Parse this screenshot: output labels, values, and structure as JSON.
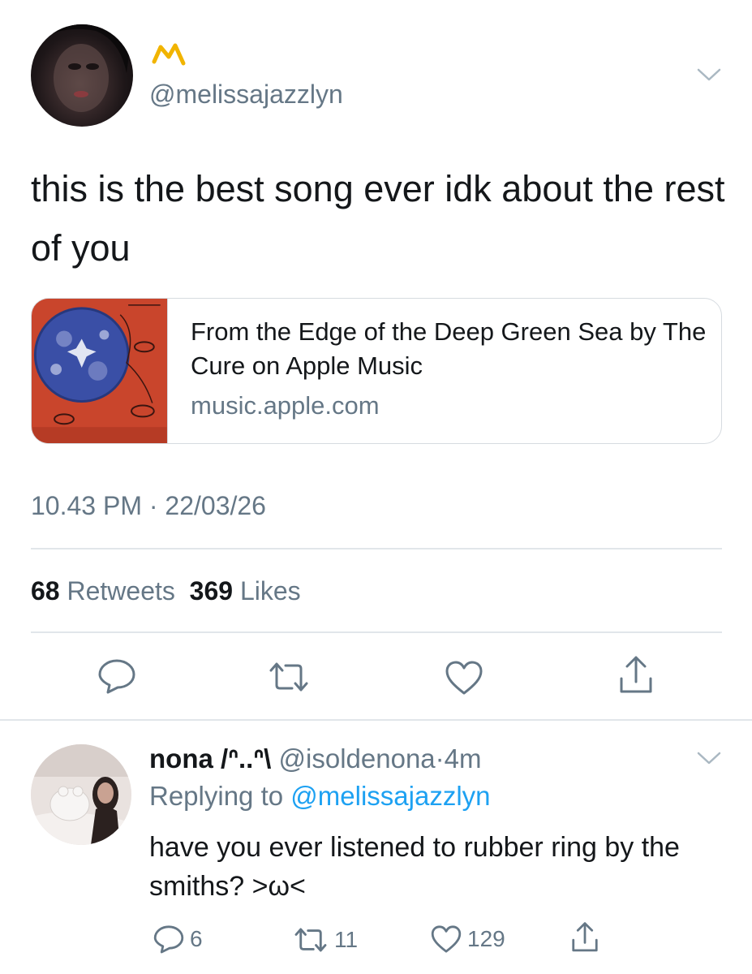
{
  "tweet": {
    "author_handle": "@melissajazzlyn",
    "text": "this is the best song ever idk about the rest of you",
    "link_card": {
      "title": "From the Edge of the Deep Green Sea by The Cure on Apple Music",
      "domain": "music.apple.com"
    },
    "timestamp": "10.43 PM · 22/03/26",
    "stats": {
      "retweets_count": "68",
      "retweets_label": "Retweets",
      "likes_count": "369",
      "likes_label": "Likes"
    },
    "actions": [
      "reply-icon",
      "retweet-icon",
      "like-icon",
      "share-icon"
    ]
  },
  "reply": {
    "display_name": "nona /ᐢ..ᐢ\\",
    "handle": "@isoldenona",
    "separator": "·",
    "time": "4m",
    "replying_label": "Replying to",
    "replying_handle": "@melissajazzlyn",
    "text": "have you ever listened to rubber ring by the smiths? >ω<",
    "counts": {
      "replies": "6",
      "retweets": "11",
      "likes": "129"
    }
  },
  "colors": {
    "text": "#14171a",
    "secondary": "#657786",
    "link": "#1da1f2",
    "divider": "#e1e6ea",
    "name_glyph": "#f1b400"
  }
}
